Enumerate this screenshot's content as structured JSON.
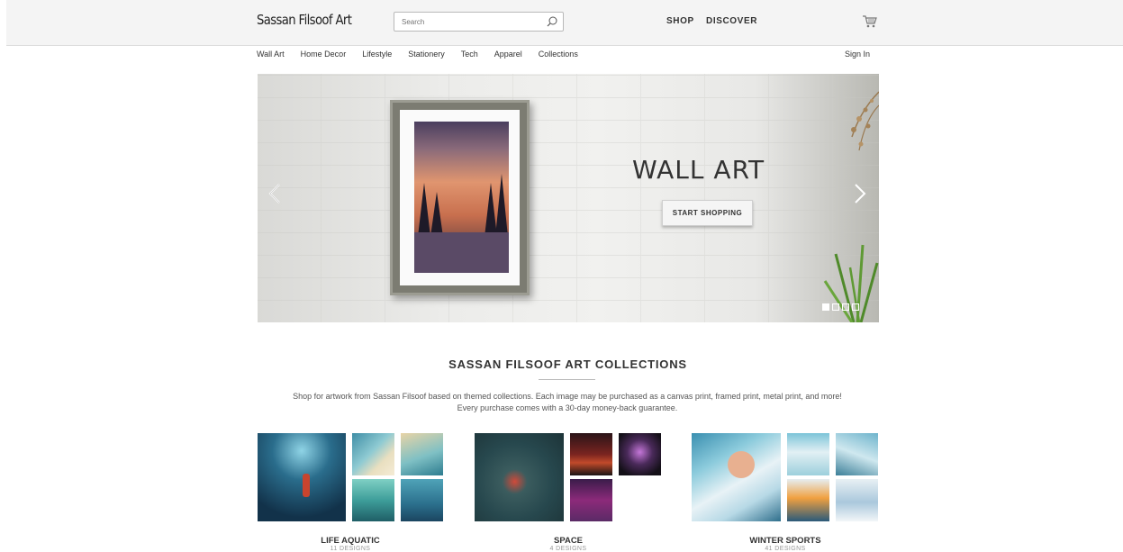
{
  "header": {
    "logo": "Sassan Filsoof Art",
    "search_placeholder": "Search",
    "nav": [
      "SHOP",
      "DISCOVER"
    ]
  },
  "categories": [
    "Wall Art",
    "Home Decor",
    "Lifestyle",
    "Stationery",
    "Tech",
    "Apparel",
    "Collections"
  ],
  "account": {
    "sign_in": "Sign In"
  },
  "hero": {
    "title": "WALL ART",
    "button": "START SHOPPING",
    "slides": 4,
    "active_slide": 1
  },
  "collections_section": {
    "title": "SASSAN FILSOOF ART COLLECTIONS",
    "description": "Shop for artwork from Sassan Filsoof based on themed collections. Each image may be purchased as a canvas print, framed print, metal print, and more! Every purchase comes with a 30-day money-back guarantee."
  },
  "collections": [
    {
      "name": "LIFE AQUATIC",
      "count": "11 DESIGNS"
    },
    {
      "name": "SPACE",
      "count": "4 DESIGNS"
    },
    {
      "name": "WINTER SPORTS",
      "count": "41 DESIGNS"
    }
  ],
  "colors": {
    "accent": "#333333",
    "topbar": "#f4f4f4"
  }
}
